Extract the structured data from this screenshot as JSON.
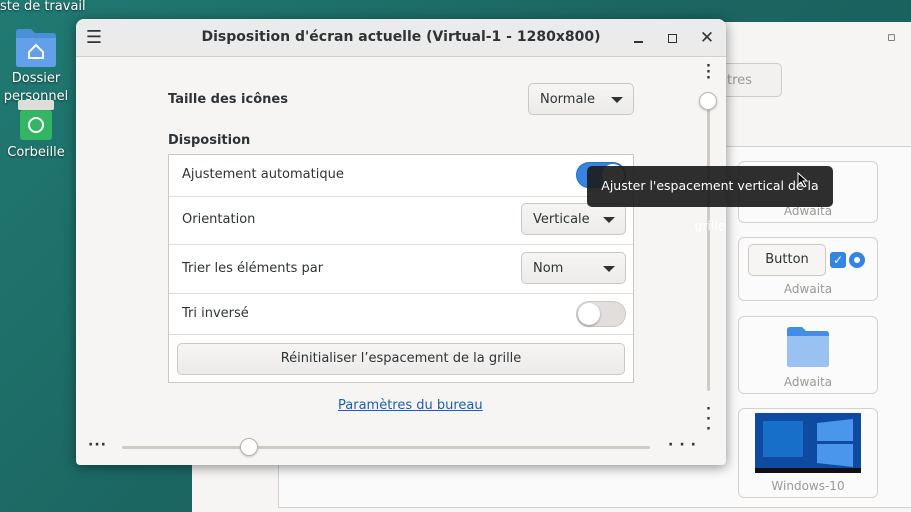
{
  "desktop": {
    "top_label": "oste de travail",
    "icons": [
      {
        "label_line1": "Dossier",
        "label_line2": "personnel"
      },
      {
        "label_line1": "Corbeille"
      }
    ]
  },
  "background_window": {
    "partial_button_label": "ètres",
    "theme_cards": [
      {
        "label": "Adwaita"
      },
      {
        "button_label": "Button",
        "label": "Adwaita"
      },
      {
        "label": "Adwaita"
      },
      {
        "label": "Windows-10"
      }
    ]
  },
  "dialog": {
    "title": "Disposition d'écran actuelle (Virtual-1 - 1280x800)",
    "icon_size_label": "Taille des icônes",
    "icon_size_value": "Normale",
    "layout_heading": "Disposition",
    "rows": {
      "auto_adjust_label": "Ajustement automatique",
      "auto_adjust_on": true,
      "orientation_label": "Orientation",
      "orientation_value": "Verticale",
      "sort_label": "Trier les éléments par",
      "sort_value": "Nom",
      "reverse_label": "Tri inversé",
      "reverse_on": false
    },
    "reset_button_label": "Réinitialiser l’espacement de la grille",
    "desktop_settings_link": "Paramètres du bureau",
    "vertical_spacing_value": 0.0,
    "horizontal_spacing_value": 0.24
  },
  "tooltip": {
    "text": "Ajuster l'espacement vertical de la grille"
  },
  "colors": {
    "accent": "#3584e4",
    "desktop_bg": "#1c6662",
    "link": "#1a5fb4"
  }
}
